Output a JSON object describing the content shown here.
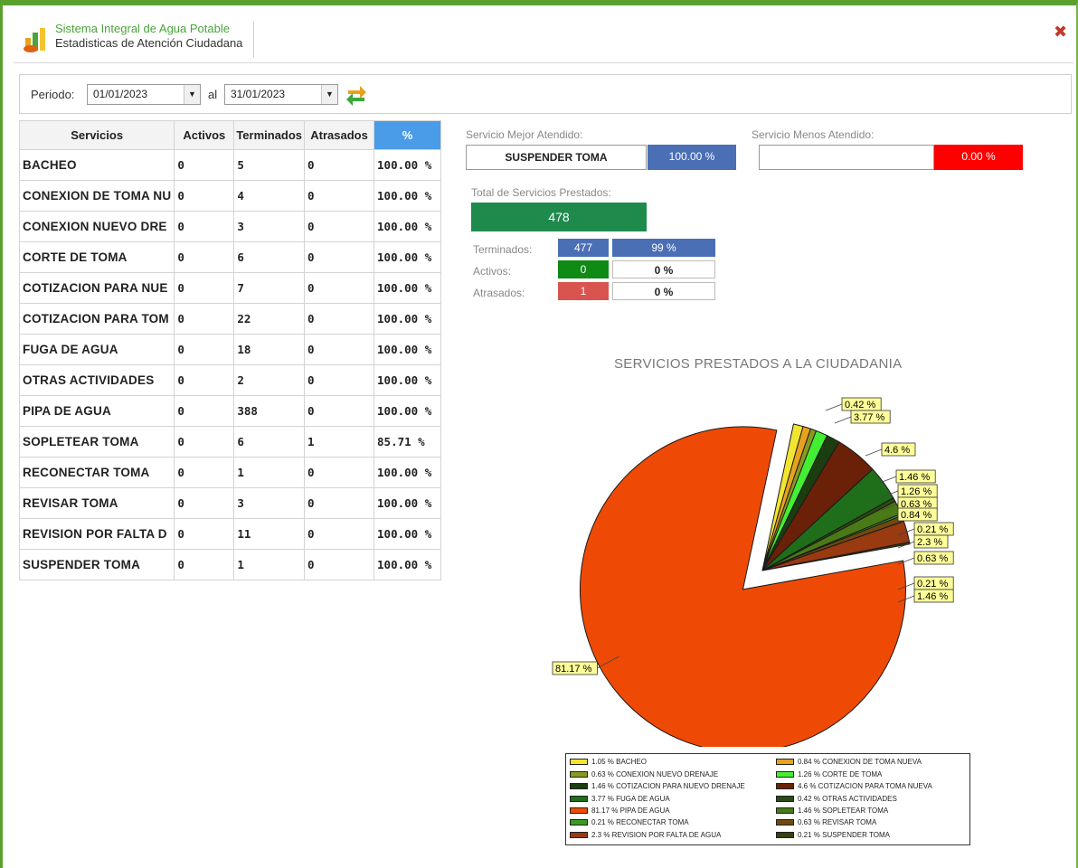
{
  "header": {
    "system_title": "Sistema Integral de Agua Potable",
    "subtitle": "Estadisticas de Atención Ciudadana"
  },
  "period": {
    "label": "Periodo:",
    "from": "01/01/2023",
    "separator": "al",
    "to": "31/01/2023"
  },
  "table": {
    "headers": [
      "Servicios",
      "Activos",
      "Terminados",
      "Atrasados",
      "%"
    ],
    "rows": [
      {
        "name": "BACHEO",
        "activos": "0",
        "terminados": "5",
        "atrasados": "0",
        "pct": "100.00 %"
      },
      {
        "name": "CONEXION DE TOMA NU",
        "activos": "0",
        "terminados": "4",
        "atrasados": "0",
        "pct": "100.00 %"
      },
      {
        "name": "CONEXION NUEVO DRE",
        "activos": "0",
        "terminados": "3",
        "atrasados": "0",
        "pct": "100.00 %"
      },
      {
        "name": "CORTE DE TOMA",
        "activos": "0",
        "terminados": "6",
        "atrasados": "0",
        "pct": "100.00 %"
      },
      {
        "name": "COTIZACION PARA NUE",
        "activos": "0",
        "terminados": "7",
        "atrasados": "0",
        "pct": "100.00 %"
      },
      {
        "name": "COTIZACION PARA TOM",
        "activos": "0",
        "terminados": "22",
        "atrasados": "0",
        "pct": "100.00 %"
      },
      {
        "name": "FUGA DE AGUA",
        "activos": "0",
        "terminados": "18",
        "atrasados": "0",
        "pct": "100.00 %"
      },
      {
        "name": "OTRAS ACTIVIDADES",
        "activos": "0",
        "terminados": "2",
        "atrasados": "0",
        "pct": "100.00 %"
      },
      {
        "name": "PIPA DE AGUA",
        "activos": "0",
        "terminados": "388",
        "atrasados": "0",
        "pct": "100.00 %"
      },
      {
        "name": "SOPLETEAR TOMA",
        "activos": "0",
        "terminados": "6",
        "atrasados": "1",
        "pct": "85.71 %"
      },
      {
        "name": "RECONECTAR TOMA",
        "activos": "0",
        "terminados": "1",
        "atrasados": "0",
        "pct": "100.00 %"
      },
      {
        "name": "REVISAR TOMA",
        "activos": "0",
        "terminados": "3",
        "atrasados": "0",
        "pct": "100.00 %"
      },
      {
        "name": "REVISION POR FALTA D",
        "activos": "0",
        "terminados": "11",
        "atrasados": "0",
        "pct": "100.00 %"
      },
      {
        "name": "SUSPENDER TOMA",
        "activos": "0",
        "terminados": "1",
        "atrasados": "0",
        "pct": "100.00 %"
      }
    ]
  },
  "stats": {
    "best_label": "Servicio Mejor Atendido:",
    "best_name": "SUSPENDER TOMA",
    "best_pct": "100.00 %",
    "worst_label": "Servicio Menos Atendido:",
    "worst_name": "",
    "worst_pct": "0.00 %",
    "total_label": "Total de Servicios Prestados:",
    "total": "478",
    "terminados_label": "Terminados:",
    "terminados_count": "477",
    "terminados_pct": "99 %",
    "activos_label": "Activos:",
    "activos_count": "0",
    "activos_pct": "0 %",
    "atrasados_label": "Atrasados:",
    "atrasados_count": "1",
    "atrasados_pct": "0 %"
  },
  "colors": {
    "brand_green": "#5aa02c",
    "best_blue": "#4a6fb5",
    "worst_red": "#ff0000",
    "total_green": "#1e8a4c",
    "header_blue": "#4a9be8"
  },
  "chart_data": {
    "type": "pie",
    "title": "SERVICIOS PRESTADOS A LA CIUDADANIA",
    "slices": [
      {
        "label": "BACHEO",
        "value": 1.05,
        "color": "#f2e530",
        "legend": "1.05 % BACHEO"
      },
      {
        "label": "CONEXION DE TOMA NUEVA",
        "value": 0.84,
        "color": "#e8a21e",
        "legend": "0.84 % CONEXION DE TOMA NUEVA"
      },
      {
        "label": "CONEXION NUEVO DRENAJE",
        "value": 0.63,
        "color": "#8a9a1e",
        "legend": "0.63 % CONEXION NUEVO DRENAJE"
      },
      {
        "label": "CORTE DE TOMA",
        "value": 1.26,
        "color": "#44ee33",
        "legend": "1.26 % CORTE DE TOMA"
      },
      {
        "label": "COTIZACION PARA NUEVO DRENAJE",
        "value": 1.46,
        "color": "#1b3d10",
        "legend": "1.46 % COTIZACION PARA NUEVO DRENAJE"
      },
      {
        "label": "COTIZACION PARA TOMA NUEVA",
        "value": 4.6,
        "color": "#6b2008",
        "legend": "4.6 % COTIZACION PARA TOMA NUEVA"
      },
      {
        "label": "FUGA DE AGUA",
        "value": 3.77,
        "color": "#1f6e1a",
        "legend": "3.77 % FUGA DE AGUA"
      },
      {
        "label": "OTRAS ACTIVIDADES",
        "value": 0.42,
        "color": "#2c4a14",
        "legend": "0.42 % OTRAS ACTIVIDADES"
      },
      {
        "label": "PIPA DE AGUA",
        "value": 81.17,
        "color": "#ee4a06",
        "legend": "81.17 % PIPA DE AGUA"
      },
      {
        "label": "SOPLETEAR TOMA",
        "value": 1.46,
        "color": "#4a7a16",
        "legend": "1.46 % SOPLETEAR TOMA"
      },
      {
        "label": "RECONECTAR TOMA",
        "value": 0.21,
        "color": "#3a9a22",
        "legend": "0.21 % RECONECTAR TOMA"
      },
      {
        "label": "REVISAR TOMA",
        "value": 0.63,
        "color": "#6e4a10",
        "legend": "0.63 % REVISAR TOMA"
      },
      {
        "label": "REVISION POR FALTA DE AGUA",
        "value": 2.3,
        "color": "#9a3a10",
        "legend": "2.3 % REVISION POR FALTA DE AGUA"
      },
      {
        "label": "SUSPENDER TOMA",
        "value": 0.21,
        "color": "#3a4010",
        "legend": "0.21 % SUSPENDER TOMA"
      }
    ],
    "data_labels": [
      "0.42 %",
      "3.77 %",
      "4.6 %",
      "1.46 %",
      "1.26 %",
      "0.63 %",
      "0.84 %",
      "0.21 %",
      "2.3 %",
      "0.63 %",
      "0.21 %",
      "1.46 %",
      "81.17 %"
    ],
    "legend_position": "bottom"
  }
}
